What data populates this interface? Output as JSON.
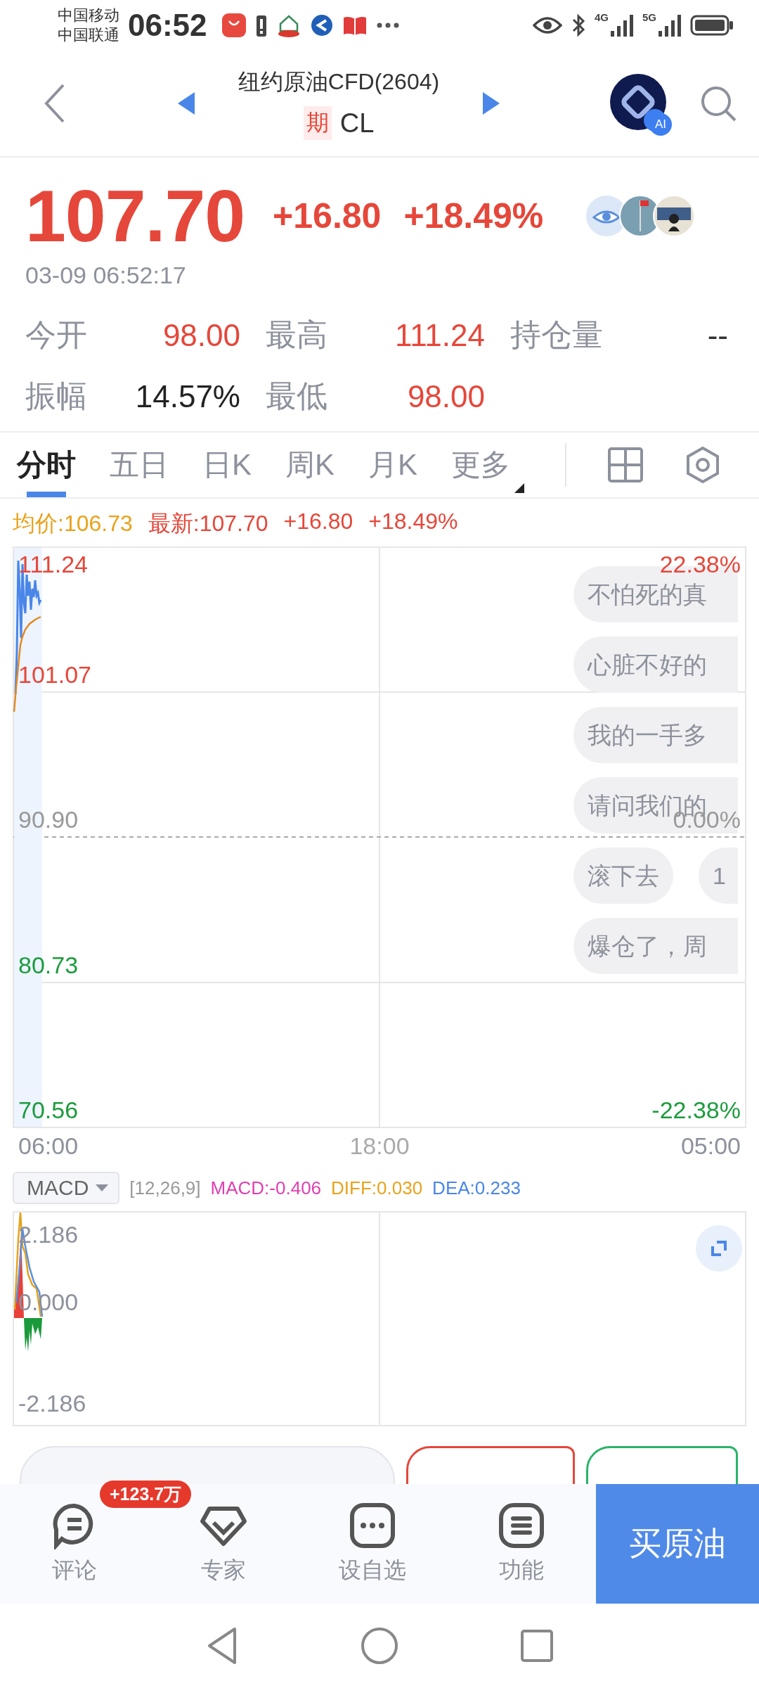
{
  "status_bar": {
    "carriers": [
      "中国移动",
      "中国联通"
    ],
    "time": "06:52",
    "networks": [
      "4G",
      "5G"
    ]
  },
  "header": {
    "title": "纽约原油CFD(2604)",
    "badge": "期",
    "code": "CL",
    "assistant_label": "AI"
  },
  "quote": {
    "price": "107.70",
    "change": "+16.80",
    "change_pct": "+18.49%",
    "time": "03-09 06:52:17"
  },
  "stats": [
    {
      "label": "今开",
      "value": "98.00",
      "kind": "up"
    },
    {
      "label": "最高",
      "value": "111.24",
      "kind": "up"
    },
    {
      "label": "持仓量",
      "value": "--",
      "kind": "none"
    },
    {
      "label": "振幅",
      "value": "14.57%",
      "kind": "flat"
    },
    {
      "label": "最低",
      "value": "98.00",
      "kind": "up"
    }
  ],
  "tabs": [
    {
      "label": "分时",
      "selected": true,
      "dropdown": false
    },
    {
      "label": "五日",
      "selected": false,
      "dropdown": false
    },
    {
      "label": "日K",
      "selected": false,
      "dropdown": false
    },
    {
      "label": "周K",
      "selected": false,
      "dropdown": false
    },
    {
      "label": "月K",
      "selected": false,
      "dropdown": false
    },
    {
      "label": "更多",
      "selected": false,
      "dropdown": true
    }
  ],
  "legend": [
    {
      "label": "均价:106.73",
      "kind": "avg"
    },
    {
      "label": "最新:107.70",
      "kind": "up"
    },
    {
      "label": "+16.80",
      "kind": "up"
    },
    {
      "label": "+18.49%",
      "kind": "up"
    }
  ],
  "chart": {
    "price_labels": [
      {
        "text": "111.24",
        "kind": "up"
      },
      {
        "text": "101.07",
        "kind": "up"
      },
      {
        "text": "90.90",
        "kind": "flat"
      },
      {
        "text": "80.73",
        "kind": "down"
      },
      {
        "text": "70.56",
        "kind": "down"
      }
    ],
    "pct_labels": [
      {
        "text": "22.38%",
        "kind": "up"
      },
      {
        "text": "0.00%",
        "kind": "flat"
      },
      {
        "text": "-22.38%",
        "kind": "down"
      }
    ],
    "time_labels": [
      "06:00",
      "18:00",
      "05:00"
    ]
  },
  "danmaku": [
    {
      "bubbles": [
        "不怕死的真"
      ]
    },
    {
      "bubbles": [
        "心脏不好的"
      ]
    },
    {
      "bubbles": [
        "我的一手多"
      ]
    },
    {
      "bubbles": [
        "请问我们的"
      ]
    },
    {
      "bubbles": [
        "滚下去",
        "1"
      ]
    },
    {
      "bubbles": [
        "爆仓了，周"
      ]
    }
  ],
  "macd": {
    "selector": "MACD",
    "params": "[12,26,9]",
    "values": [
      {
        "label": "MACD:-0.406",
        "kind": "macd"
      },
      {
        "label": "DIFF:0.030",
        "kind": "diff"
      },
      {
        "label": "DEA:0.233",
        "kind": "dea"
      }
    ],
    "axis_labels": [
      "2.186",
      "0.000",
      "-2.186"
    ]
  },
  "bottom_nav": [
    {
      "label": "评论",
      "kind": "comment",
      "badge": "+123.7万"
    },
    {
      "label": "专家",
      "kind": "expert"
    },
    {
      "label": "设自选",
      "kind": "add"
    },
    {
      "label": "功能",
      "kind": "menu"
    }
  ],
  "buy_button": "买原油"
}
